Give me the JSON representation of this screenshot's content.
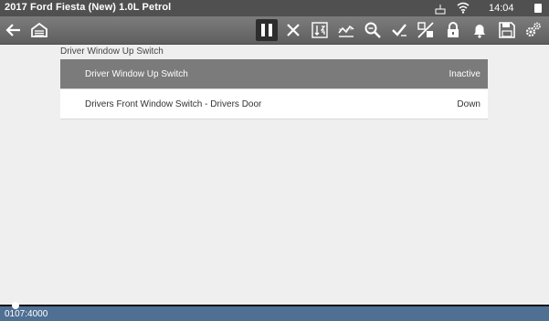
{
  "status_bar": {
    "vehicle_title": "2017 Ford Fiesta (New) 1.0L Petrol",
    "time": "14:04",
    "icons": [
      "keyboard-icon",
      "wifi-icon",
      "battery-icon"
    ]
  },
  "toolbar": {
    "left_icons": [
      "back-arrow-icon",
      "garage-home-icon"
    ],
    "right_icons": [
      "pause-icon",
      "close-icon",
      "sort-icon",
      "graph-icon",
      "zoom-icon",
      "check-icon",
      "percent-icon",
      "lock-icon",
      "bell-icon",
      "save-icon",
      "settings-icon"
    ]
  },
  "content": {
    "section_title": "Driver Window Up Switch",
    "rows": [
      {
        "name": "Driver Window Up Switch",
        "value": "Inactive"
      },
      {
        "name": "Drivers Front Window Switch - Drivers Door",
        "value": "Down"
      }
    ]
  },
  "bottom_bar": {
    "timestamp": "0107:4000"
  },
  "colors": {
    "status_bar": "#505050",
    "toolbar": "#6e6e6e",
    "selected_row": "#7b7b7b",
    "bottom_bar": "#4f6f93",
    "background": "#efefef"
  }
}
